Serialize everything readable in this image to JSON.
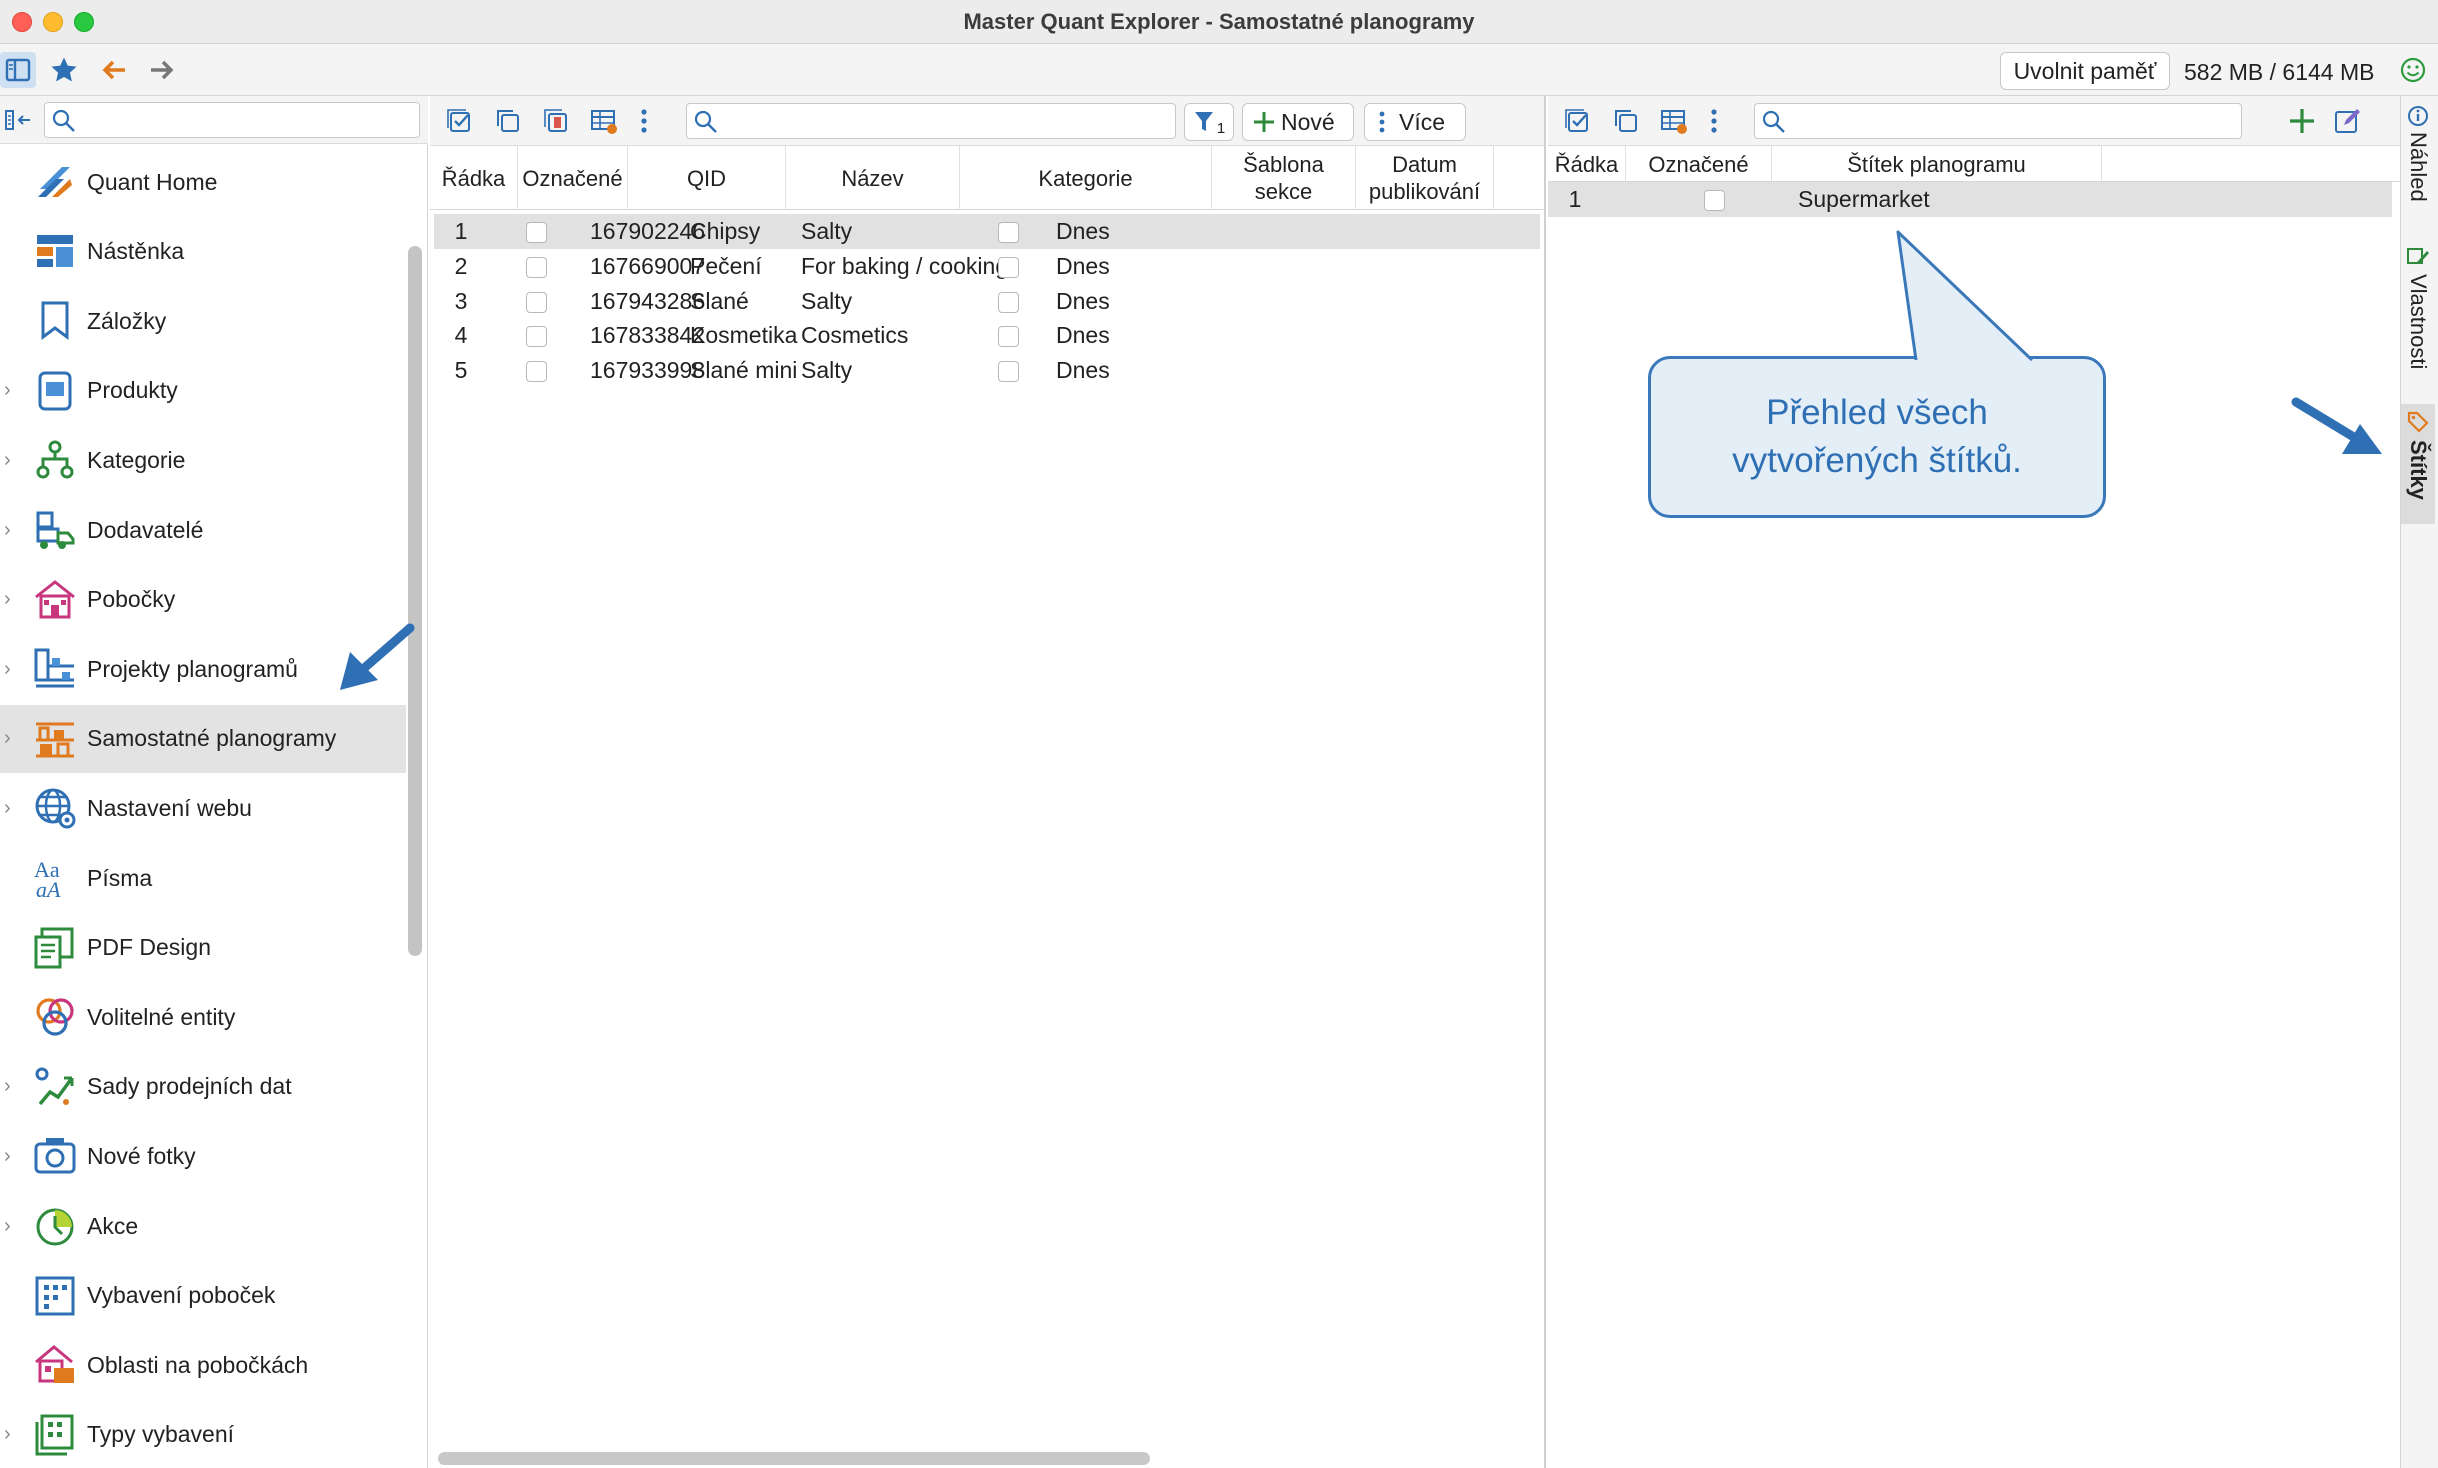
{
  "window": {
    "title": "Master Quant Explorer - Samostatné planogramy"
  },
  "toolbar": {
    "icons": [
      "sidebar-toggle-icon",
      "star-icon",
      "arrow-left-icon",
      "arrow-right-icon"
    ],
    "free_memory_label": "Uvolnit paměť",
    "memory_usage": "582 MB / 6144 MB",
    "status_icon": "smiley-icon"
  },
  "nav": {
    "search_placeholder": "",
    "items": [
      {
        "label": "Quant Home",
        "icon": "quant-home-icon",
        "expandable": false
      },
      {
        "label": "Nástěnka",
        "icon": "dashboard-icon",
        "expandable": false
      },
      {
        "label": "Záložky",
        "icon": "bookmark-icon",
        "expandable": false
      },
      {
        "label": "Produkty",
        "icon": "product-icon",
        "expandable": true
      },
      {
        "label": "Kategorie",
        "icon": "category-tree-icon",
        "expandable": true
      },
      {
        "label": "Dodavatelé",
        "icon": "supplier-icon",
        "expandable": true
      },
      {
        "label": "Pobočky",
        "icon": "store-icon",
        "expandable": true
      },
      {
        "label": "Projekty planogramů",
        "icon": "planogram-project-icon",
        "expandable": true
      },
      {
        "label": "Samostatné planogramy",
        "icon": "planogram-icon",
        "expandable": true
      },
      {
        "label": "Nastavení webu",
        "icon": "web-settings-icon",
        "expandable": true
      },
      {
        "label": "Písma",
        "icon": "fonts-icon",
        "expandable": false
      },
      {
        "label": "PDF Design",
        "icon": "pdf-design-icon",
        "expandable": false
      },
      {
        "label": "Volitelné entity",
        "icon": "optional-entities-icon",
        "expandable": false
      },
      {
        "label": "Sady prodejních dat",
        "icon": "sales-data-icon",
        "expandable": true
      },
      {
        "label": "Nové fotky",
        "icon": "camera-icon",
        "expandable": true
      },
      {
        "label": "Akce",
        "icon": "promotion-icon",
        "expandable": true
      },
      {
        "label": "Vybavení poboček",
        "icon": "store-equipment-icon",
        "expandable": false
      },
      {
        "label": "Oblasti na pobočkách",
        "icon": "store-areas-icon",
        "expandable": false
      },
      {
        "label": "Typy vybavení",
        "icon": "equipment-types-icon",
        "expandable": true
      }
    ],
    "selected_index": 8
  },
  "planograms": {
    "filter_count": "1",
    "new_label": "Nové",
    "more_label": "Více",
    "columns": [
      "Řádka",
      "Označené",
      "QID",
      "Název",
      "Kategorie",
      "Šablona sekce",
      "Datum publikování"
    ],
    "rows": [
      {
        "row": "1",
        "qid": "167902246",
        "name": "Chipsy",
        "category": "Salty",
        "published": "Dnes"
      },
      {
        "row": "2",
        "qid": "167669007",
        "name": "Pečení",
        "category": "For baking / cooking",
        "published": "Dnes"
      },
      {
        "row": "3",
        "qid": "167943286",
        "name": "Slané",
        "category": "Salty",
        "published": "Dnes"
      },
      {
        "row": "4",
        "qid": "167833842",
        "name": "Kosmetika",
        "category": "Cosmetics",
        "published": "Dnes"
      },
      {
        "row": "5",
        "qid": "167933998",
        "name": "Slané mini",
        "category": "Salty",
        "published": "Dnes"
      }
    ]
  },
  "tags": {
    "columns": [
      "Řádka",
      "Označené",
      "Štítek planogramu"
    ],
    "rows": [
      {
        "row": "1",
        "tag": "Supermarket"
      }
    ]
  },
  "side_tabs": [
    {
      "label": "Náhled",
      "icon": "info-icon"
    },
    {
      "label": "Vlastnosti",
      "icon": "properties-icon"
    },
    {
      "label": "Štítky",
      "icon": "tag-icon",
      "active": true
    }
  ],
  "annotation": {
    "callout_line1": "Přehled všech",
    "callout_line2": "vytvořených štítků.",
    "color": "#3a78ba"
  }
}
